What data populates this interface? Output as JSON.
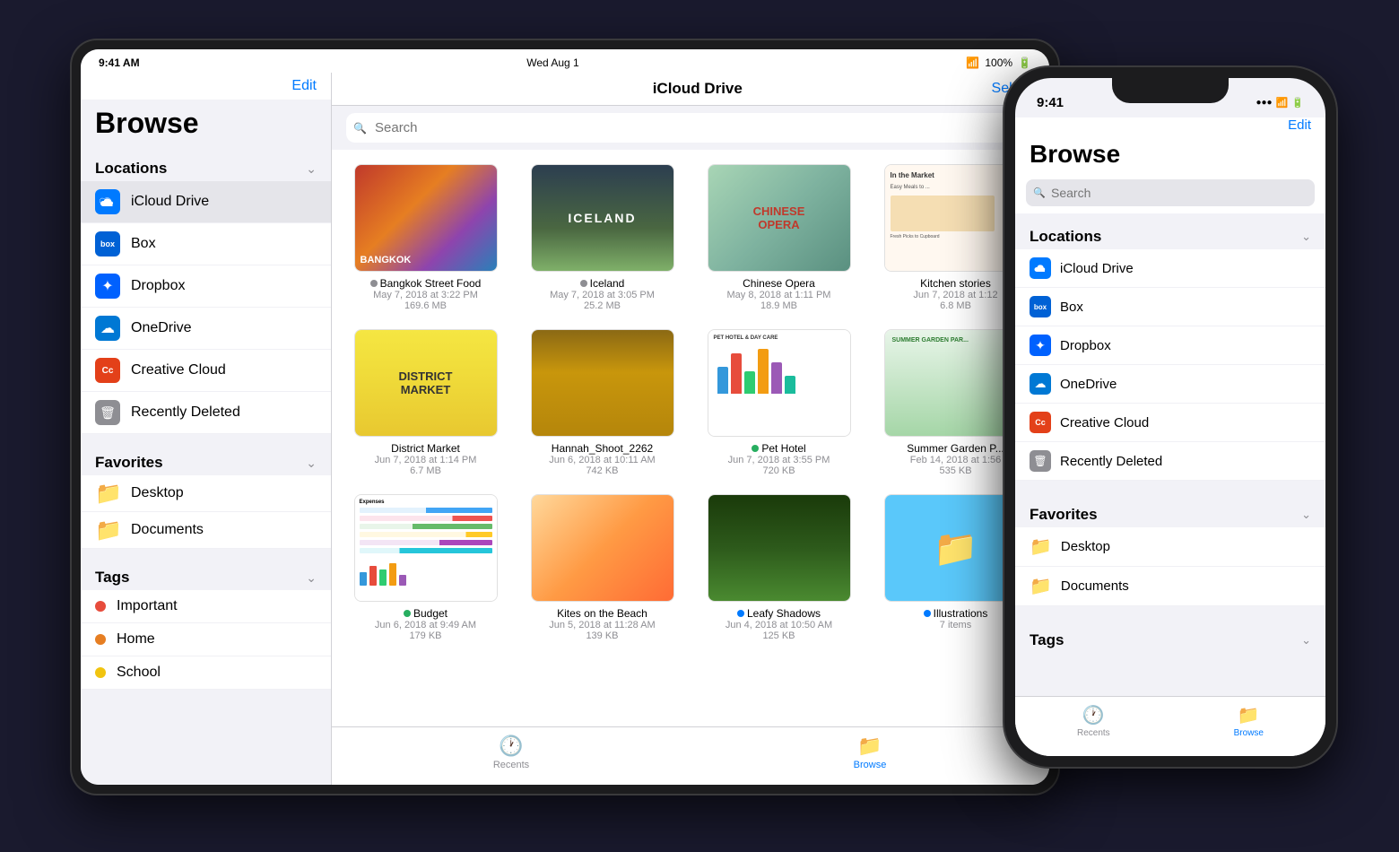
{
  "scene": {
    "background": "#1a1a2e"
  },
  "ipad": {
    "status": {
      "time": "9:41 AM",
      "date": "Wed Aug 1",
      "wifi": "WiFi",
      "battery": "100%"
    },
    "header": {
      "edit_label": "Edit",
      "title": "iCloud Drive",
      "select_label": "Select"
    },
    "search": {
      "placeholder": "Search"
    },
    "browse_title": "Browse",
    "sidebar": {
      "locations_label": "Locations",
      "items": [
        {
          "id": "icloud-drive",
          "label": "iCloud Drive",
          "active": true
        },
        {
          "id": "box",
          "label": "Box"
        },
        {
          "id": "dropbox",
          "label": "Dropbox"
        },
        {
          "id": "onedrive",
          "label": "OneDrive"
        },
        {
          "id": "creative-cloud",
          "label": "Creative Cloud"
        },
        {
          "id": "recently-deleted",
          "label": "Recently Deleted"
        }
      ],
      "favorites_label": "Favorites",
      "favorites": [
        {
          "id": "desktop",
          "label": "Desktop"
        },
        {
          "id": "documents",
          "label": "Documents"
        }
      ],
      "tags_label": "Tags",
      "tags": [
        {
          "id": "important",
          "label": "Important",
          "color": "#e74c3c"
        },
        {
          "id": "home",
          "label": "Home",
          "color": "#e67e22"
        },
        {
          "id": "school",
          "label": "School",
          "color": "#f1c40f"
        }
      ]
    },
    "files": [
      {
        "id": "bangkok",
        "name": "Bangkok Street Food",
        "date": "May 7, 2018 at 3:22 PM",
        "size": "169.6 MB",
        "status": "gray",
        "thumb_type": "bangkok"
      },
      {
        "id": "iceland",
        "name": "Iceland",
        "date": "May 7, 2018 at 3:05 PM",
        "size": "25.2 MB",
        "status": "gray",
        "thumb_type": "iceland"
      },
      {
        "id": "chinese-opera",
        "name": "Chinese Opera",
        "date": "May 8, 2018 at 1:11 PM",
        "size": "18.9 MB",
        "status": "none",
        "thumb_type": "chinese-opera"
      },
      {
        "id": "kitchen-stories",
        "name": "Kitchen stories",
        "date": "Jun 7, 2018 at 1:12",
        "size": "6.8 MB",
        "status": "none",
        "thumb_type": "kitchen"
      },
      {
        "id": "district-market",
        "name": "District Market",
        "date": "Jun 7, 2018 at 1:14 PM",
        "size": "6.7 MB",
        "status": "none",
        "thumb_type": "district"
      },
      {
        "id": "hannah-shoot",
        "name": "Hannah_Shoot_2262",
        "date": "Jun 6, 2018 at 10:11 AM",
        "size": "742 KB",
        "status": "none",
        "thumb_type": "hannah"
      },
      {
        "id": "pet-hotel",
        "name": "Pet Hotel",
        "date": "Jun 7, 2018 at 3:55 PM",
        "size": "720 KB",
        "status": "green",
        "thumb_type": "pet-hotel"
      },
      {
        "id": "summer-garden",
        "name": "Summer Garden P...",
        "date": "Feb 14, 2018 at 1:56",
        "size": "535 KB",
        "status": "none",
        "thumb_type": "summer"
      },
      {
        "id": "budget",
        "name": "Budget",
        "date": "Jun 6, 2018 at 9:49 AM",
        "size": "179 KB",
        "status": "green",
        "thumb_type": "budget"
      },
      {
        "id": "kites-beach",
        "name": "Kites on the Beach",
        "date": "Jun 5, 2018 at 11:28 AM",
        "size": "139 KB",
        "status": "none",
        "thumb_type": "kites"
      },
      {
        "id": "leafy-shadows",
        "name": "Leafy Shadows",
        "date": "Jun 4, 2018 at 10:50 AM",
        "size": "125 KB",
        "status": "blue",
        "thumb_type": "leafy"
      },
      {
        "id": "illustrations",
        "name": "Illustrations",
        "meta": "7 items",
        "status": "blue",
        "thumb_type": "illustrations"
      }
    ],
    "tabs": [
      {
        "id": "recents",
        "label": "Recents",
        "icon": "🕐"
      },
      {
        "id": "browse",
        "label": "Browse",
        "icon": "📁",
        "active": true
      }
    ]
  },
  "iphone": {
    "status": {
      "time": "9:41",
      "signal": "●●●",
      "wifi": "WiFi",
      "battery": "▮"
    },
    "header": {
      "edit_label": "Edit"
    },
    "browse_title": "Browse",
    "search": {
      "placeholder": "Search"
    },
    "sidebar": {
      "locations_label": "Locations",
      "items": [
        {
          "id": "icloud-drive",
          "label": "iCloud Drive"
        },
        {
          "id": "box",
          "label": "Box"
        },
        {
          "id": "dropbox",
          "label": "Dropbox"
        },
        {
          "id": "onedrive",
          "label": "OneDrive"
        },
        {
          "id": "creative-cloud",
          "label": "Creative Cloud"
        },
        {
          "id": "recently-deleted",
          "label": "Recently Deleted"
        }
      ],
      "favorites_label": "Favorites",
      "favorites": [
        {
          "id": "desktop",
          "label": "Desktop"
        },
        {
          "id": "documents",
          "label": "Documents"
        }
      ],
      "tags_label": "Tags"
    },
    "tabs": [
      {
        "id": "recents",
        "label": "Recents",
        "icon": "🕐"
      },
      {
        "id": "browse",
        "label": "Browse",
        "icon": "📁",
        "active": true
      }
    ]
  }
}
